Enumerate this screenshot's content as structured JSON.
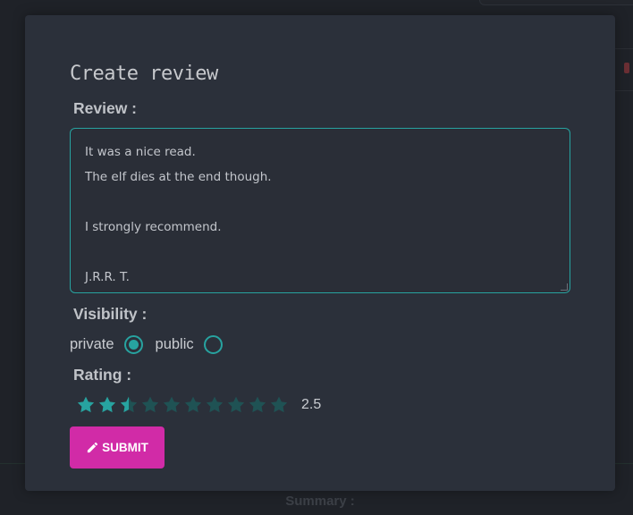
{
  "modal": {
    "title": "Create review",
    "review": {
      "label": "Review :",
      "lines": [
        "It was a nice read.",
        "The elf dies at the end though.",
        "",
        "I strongly recommend.",
        "",
        "J.R.R. T."
      ]
    },
    "visibility": {
      "label": "Visibility :",
      "options": [
        {
          "label": "private",
          "checked": true
        },
        {
          "label": "public",
          "checked": false
        }
      ]
    },
    "rating": {
      "label": "Rating :",
      "max": 10,
      "value": 2.5,
      "value_text": "2.5"
    },
    "submit": {
      "label": "SUBMIT",
      "icon": "pencil-icon"
    }
  },
  "background": {
    "summary_label": "Summary :"
  },
  "colors": {
    "accent": "#27a3a0",
    "star_empty": "#1f5254",
    "submit": "#d12ba7",
    "modal_bg": "#2b303a"
  }
}
